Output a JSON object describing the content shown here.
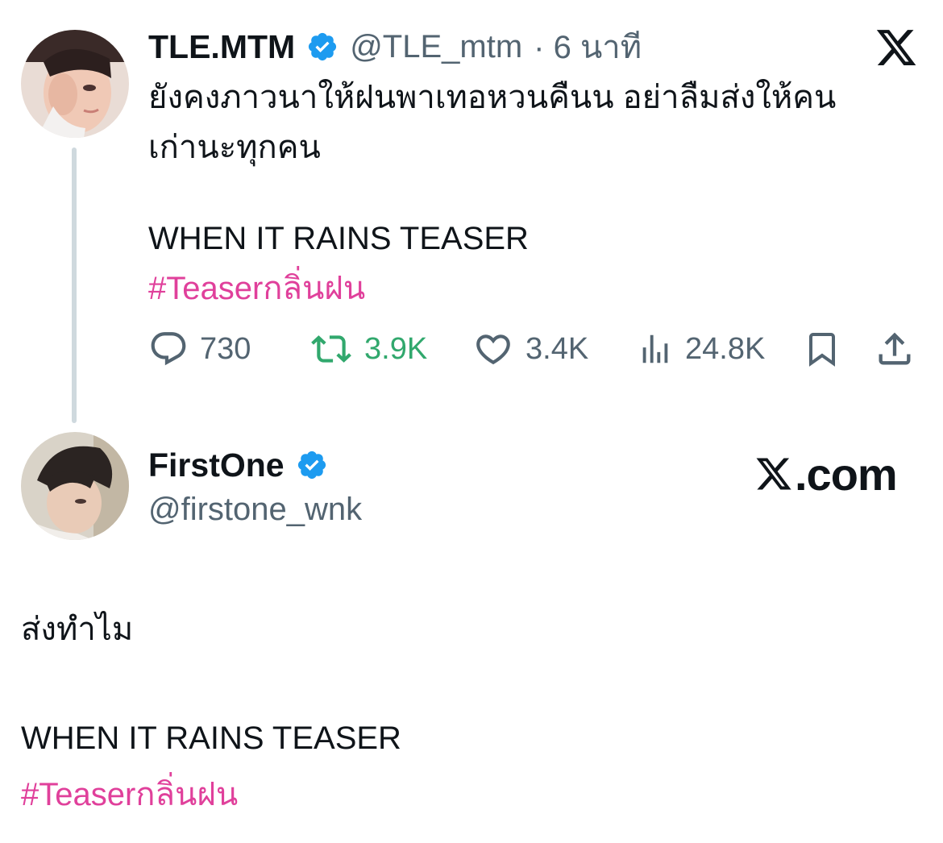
{
  "tweet": {
    "author": {
      "display_name": "TLE.MTM",
      "handle": "@TLE_mtm",
      "time": "· 6 นาที",
      "verified": true
    },
    "text_lines": [
      "ยังคงภาวนาให้ฝนพาเทอหวนคืนน อย่าลืมส่งให้คน",
      "เก่านะทุกคน",
      "WHEN IT RAINS TEASER"
    ],
    "hashtag": "#Teaserกลิ่นฝน",
    "stats": {
      "replies": "730",
      "retweets": "3.9K",
      "likes": "3.4K",
      "views": "24.8K"
    }
  },
  "quoted": {
    "author": {
      "display_name": "FirstOne",
      "handle": "@firstone_wnk",
      "verified": true
    },
    "brand": ".com",
    "text_lines": [
      "ส่งทำไม",
      "WHEN IT RAINS TEASER"
    ],
    "hashtag": "#Teaserกลิ่นฝน"
  },
  "colors": {
    "accent_hashtag": "#e0409b",
    "retweet_green": "#31a86d",
    "verified_blue": "#1d9bf0",
    "muted_text": "#536471"
  }
}
